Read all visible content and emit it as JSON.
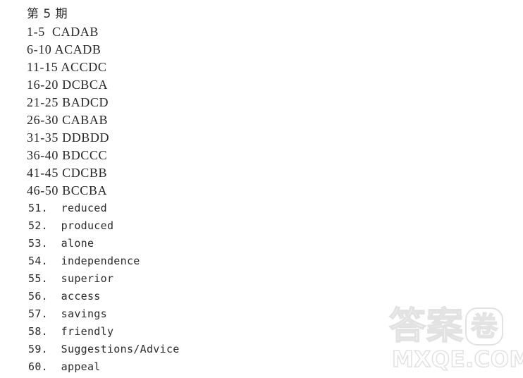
{
  "document": {
    "title": "第 5 期",
    "answer_key": [
      {
        "range": "1-5",
        "answers": "CADAB",
        "text": "1-5  CADAB"
      },
      {
        "range": "6-10",
        "answers": "ACADB",
        "text": "6-10 ACADB"
      },
      {
        "range": "11-15",
        "answers": "ACCDC",
        "text": "11-15 ACCDC"
      },
      {
        "range": "16-20",
        "answers": "DCBCA",
        "text": "16-20 DCBCA"
      },
      {
        "range": "21-25",
        "answers": "BADCD",
        "text": "21-25 BADCD"
      },
      {
        "range": "26-30",
        "answers": "CABAB",
        "text": "26-30 CABAB"
      },
      {
        "range": "31-35",
        "answers": "DDBDD",
        "text": "31-35 DDBDD"
      },
      {
        "range": "36-40",
        "answers": "BDCCC",
        "text": "36-40 BDCCC"
      },
      {
        "range": "41-45",
        "answers": "CDCBB",
        "text": "41-45 CDCBB"
      },
      {
        "range": "46-50",
        "answers": "BCCBA",
        "text": "46-50 BCCBA"
      }
    ],
    "word_answers": [
      {
        "number": "51.",
        "word": "reduced",
        "text": "51.  reduced"
      },
      {
        "number": "52.",
        "word": "produced",
        "text": "52.  produced"
      },
      {
        "number": "53.",
        "word": "alone",
        "text": "53.  alone"
      },
      {
        "number": "54.",
        "word": "independence",
        "text": "54.  independence"
      },
      {
        "number": "55.",
        "word": "superior",
        "text": "55.  superior"
      },
      {
        "number": "56.",
        "word": "access",
        "text": "56.  access"
      },
      {
        "number": "57.",
        "word": "savings",
        "text": "57.  savings"
      },
      {
        "number": "58.",
        "word": "friendly",
        "text": "58.  friendly"
      },
      {
        "number": "59.",
        "word": "Suggestions/Advice",
        "text": "59.  Suggestions/Advice"
      },
      {
        "number": "60.",
        "word": "appeal",
        "text": "60.  appeal"
      }
    ]
  },
  "watermark": {
    "cjk_text": "答案",
    "badge_char": "卷",
    "domain": "MXQE.COM",
    "color": "#e2e2e2"
  },
  "colors": {
    "background": "#ffffff",
    "text": "#262626",
    "watermark": "#e2e2e2"
  }
}
